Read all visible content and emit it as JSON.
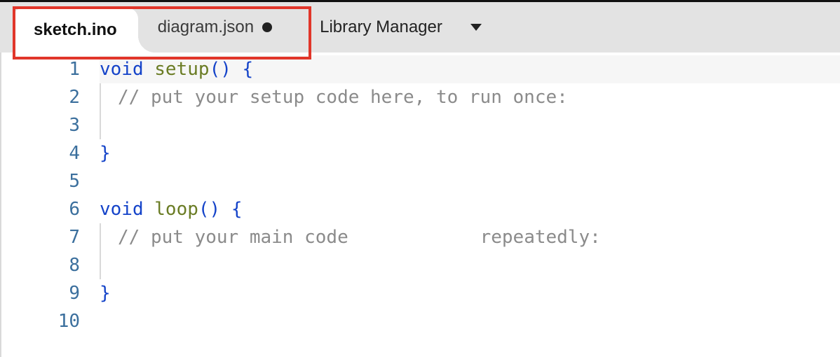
{
  "tabs": {
    "active": {
      "label": "sketch.ino"
    },
    "second": {
      "label": "diagram.json",
      "dirty": true
    }
  },
  "menu": {
    "library_manager": "Library Manager"
  },
  "editor": {
    "line_numbers": [
      "1",
      "2",
      "3",
      "4",
      "5",
      "6",
      "7",
      "8",
      "9",
      "10"
    ],
    "lines": {
      "l1": {
        "kw": "void",
        "fn": "setup",
        "paren": "()",
        "brace": "{"
      },
      "l2": {
        "comment": "// put your setup code here, to run once:"
      },
      "l4": {
        "brace": "}"
      },
      "l6": {
        "kw": "void",
        "fn": "loop",
        "paren": "()",
        "brace": "{"
      },
      "l7": {
        "comment_a": "// put your main code",
        "comment_b": "repeatedly:"
      },
      "l9": {
        "brace": "}"
      }
    }
  }
}
